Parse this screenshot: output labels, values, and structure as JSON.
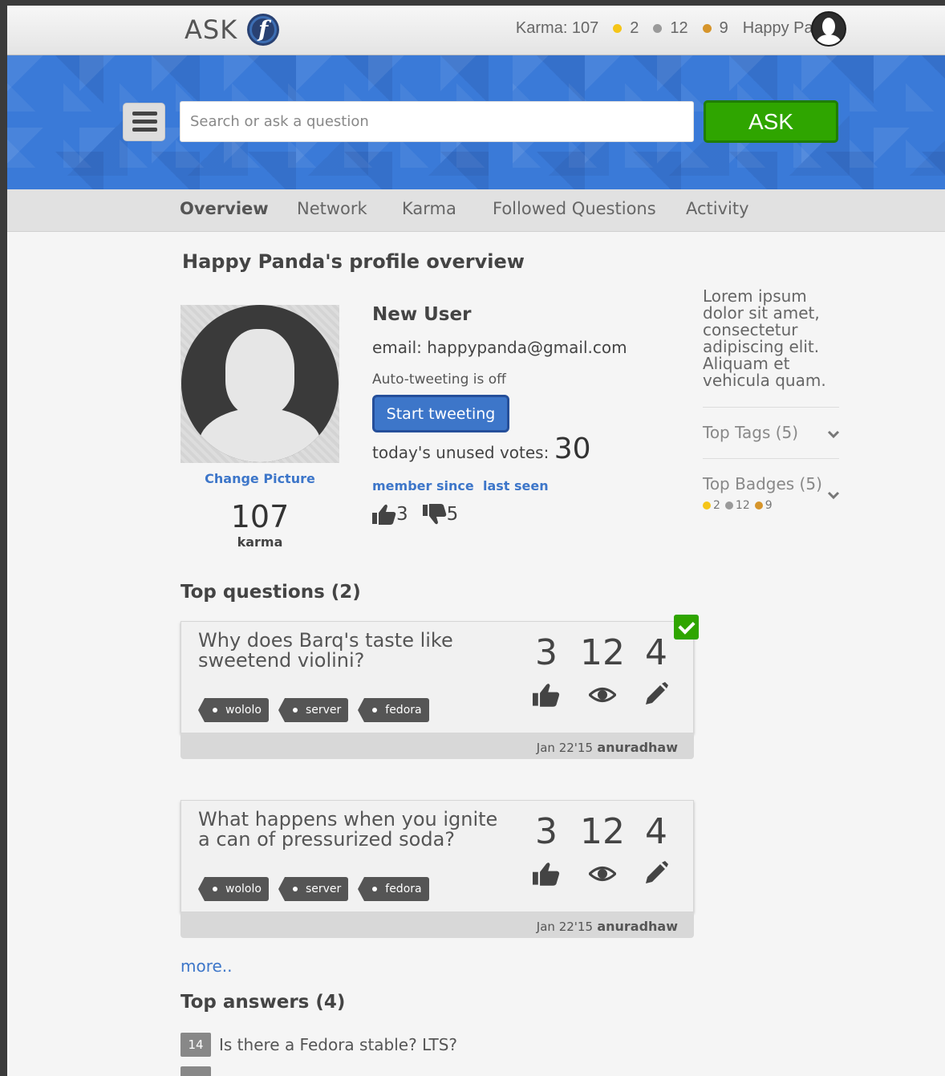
{
  "header": {
    "brand": "ASK",
    "karma": "Karma: 107",
    "badges": [
      {
        "count": "2",
        "color": "#f5c518"
      },
      {
        "count": "12",
        "color": "#9a9a9a"
      },
      {
        "count": "9",
        "color": "#d6952b"
      }
    ],
    "username": "Happy Panda"
  },
  "search": {
    "placeholder": "Search or ask a question",
    "ask_label": "ASK"
  },
  "tabs": [
    "Overview",
    "Network",
    "Karma",
    "Followed Questions",
    "Activity"
  ],
  "profile": {
    "title": "Happy Panda's profile overview",
    "change_picture": "Change Picture",
    "karma_value": "107",
    "karma_label": "karma",
    "role": "New User",
    "email": "email: happypanda@gmail.com",
    "autotweet": "Auto-tweeting is off",
    "tweet_button": "Start tweeting",
    "unused_votes_label": "today's unused votes: ",
    "unused_votes_value": "30",
    "member_since": "member since",
    "last_seen": "last seen",
    "upvotes": "3",
    "downvotes": "5"
  },
  "sidebar": {
    "lorem": "Lorem ipsum dolor sit amet, consectetur adipiscing elit. Aliquam et vehicula quam.",
    "top_tags": "Top Tags (5)",
    "top_badges": "Top Badges (5)",
    "badge_counts": [
      {
        "count": "2",
        "color": "#f5c518"
      },
      {
        "count": "12",
        "color": "#9a9a9a"
      },
      {
        "count": "9",
        "color": "#d6952b"
      }
    ]
  },
  "top_questions": {
    "heading": "Top questions (2)",
    "items": [
      {
        "title": "Why does Barq's taste like sweetend violini?",
        "tags": [
          "wololo",
          "server",
          "fedora"
        ],
        "votes": "3",
        "views": "12",
        "edits": "4",
        "date": "Jan 22'15",
        "author": "anuradhaw",
        "accepted": true
      },
      {
        "title": "What happens when you ignite a can of pressurized soda?",
        "tags": [
          "wololo",
          "server",
          "fedora"
        ],
        "votes": "3",
        "views": "12",
        "edits": "4",
        "date": "Jan 22'15",
        "author": "anuradhaw",
        "accepted": false
      }
    ],
    "more": "more.."
  },
  "top_answers": {
    "heading": "Top answers (4)",
    "items": [
      {
        "count": "14",
        "title": "Is there a Fedora stable? LTS?"
      }
    ]
  }
}
